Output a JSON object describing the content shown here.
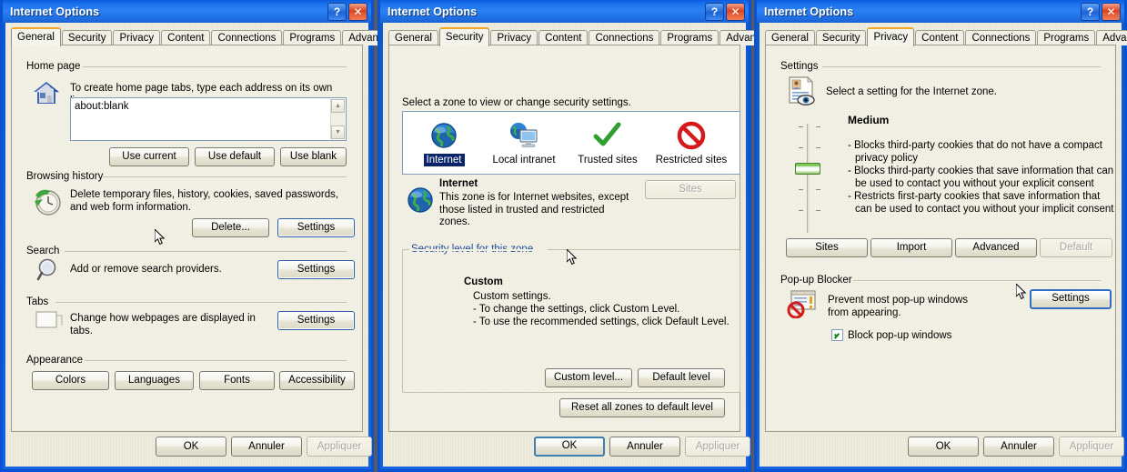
{
  "common": {
    "title": "Internet Options",
    "help_button": "?",
    "close_button": "✕",
    "tabs": [
      "General",
      "Security",
      "Privacy",
      "Content",
      "Connections",
      "Programs",
      "Advanced"
    ],
    "footer": {
      "ok": "OK",
      "cancel": "Annuler",
      "apply": "Appliquer"
    },
    "colors": {
      "titlebar_blue": "#0b50c8",
      "active_tab_accent": "#f0a828",
      "dialog_face": "#ece9d8",
      "panel_face": "#f1efe2",
      "selection_blue": "#0a246a",
      "field_border": "#7f9db9"
    }
  },
  "window1": {
    "title": "Internet Options",
    "active_tab": "General",
    "home_page": {
      "legend": "Home page",
      "description": "To create home page tabs, type each address on its own line.",
      "value": "about:blank",
      "buttons": [
        "Use current",
        "Use default",
        "Use blank"
      ]
    },
    "browsing_history": {
      "legend": "Browsing history",
      "description": "Delete temporary files, history, cookies, saved passwords, and web form information.",
      "buttons": [
        "Delete...",
        "Settings"
      ]
    },
    "search": {
      "legend": "Search",
      "description": "Add or remove search providers.",
      "button": "Settings"
    },
    "tabs_section": {
      "legend": "Tabs",
      "description": "Change how webpages are displayed in tabs.",
      "button": "Settings"
    },
    "appearance": {
      "legend": "Appearance",
      "buttons": [
        "Colors",
        "Languages",
        "Fonts",
        "Accessibility"
      ]
    }
  },
  "window2": {
    "title": "Internet Options",
    "active_tab": "Security",
    "zone_prompt": "Select a zone to view or change security settings.",
    "zones": [
      {
        "label": "Internet",
        "icon": "globe-icon",
        "selected": true
      },
      {
        "label": "Local intranet",
        "icon": "intranet-icon",
        "selected": false
      },
      {
        "label": "Trusted sites",
        "icon": "checkmark-icon",
        "selected": false
      },
      {
        "label": "Restricted sites",
        "icon": "restricted-icon",
        "selected": false
      }
    ],
    "zone_detail": {
      "name": "Internet",
      "description": "This zone is for Internet websites, except those listed in trusted and restricted zones.",
      "sites_button": "Sites",
      "sites_disabled": true
    },
    "security_level": {
      "legend": "Security level for this zone",
      "level": "Custom",
      "lines": [
        "Custom settings.",
        "- To change the settings, click Custom Level.",
        "- To use the recommended settings, click Default Level."
      ],
      "buttons": [
        "Custom level...",
        "Default level"
      ]
    },
    "reset_button": "Reset all zones to default level"
  },
  "window3": {
    "title": "Internet Options",
    "active_tab": "Privacy",
    "settings": {
      "legend": "Settings",
      "description": "Select a setting for the Internet zone.",
      "level": "Medium",
      "lines": [
        "- Blocks third-party cookies that do not have a compact",
        "privacy policy",
        "- Blocks third-party cookies that save information that can",
        "be used to contact you without your explicit consent",
        "- Restricts first-party cookies that save information that",
        "can be used to contact you without your implicit consent"
      ],
      "buttons": [
        "Sites",
        "Import",
        "Advanced",
        "Default"
      ],
      "default_disabled": true
    },
    "popup_blocker": {
      "legend": "Pop-up Blocker",
      "description": "Prevent most pop-up windows from appearing.",
      "checkbox_label": "Block pop-up windows",
      "checkbox_checked": true,
      "button": "Settings"
    }
  }
}
